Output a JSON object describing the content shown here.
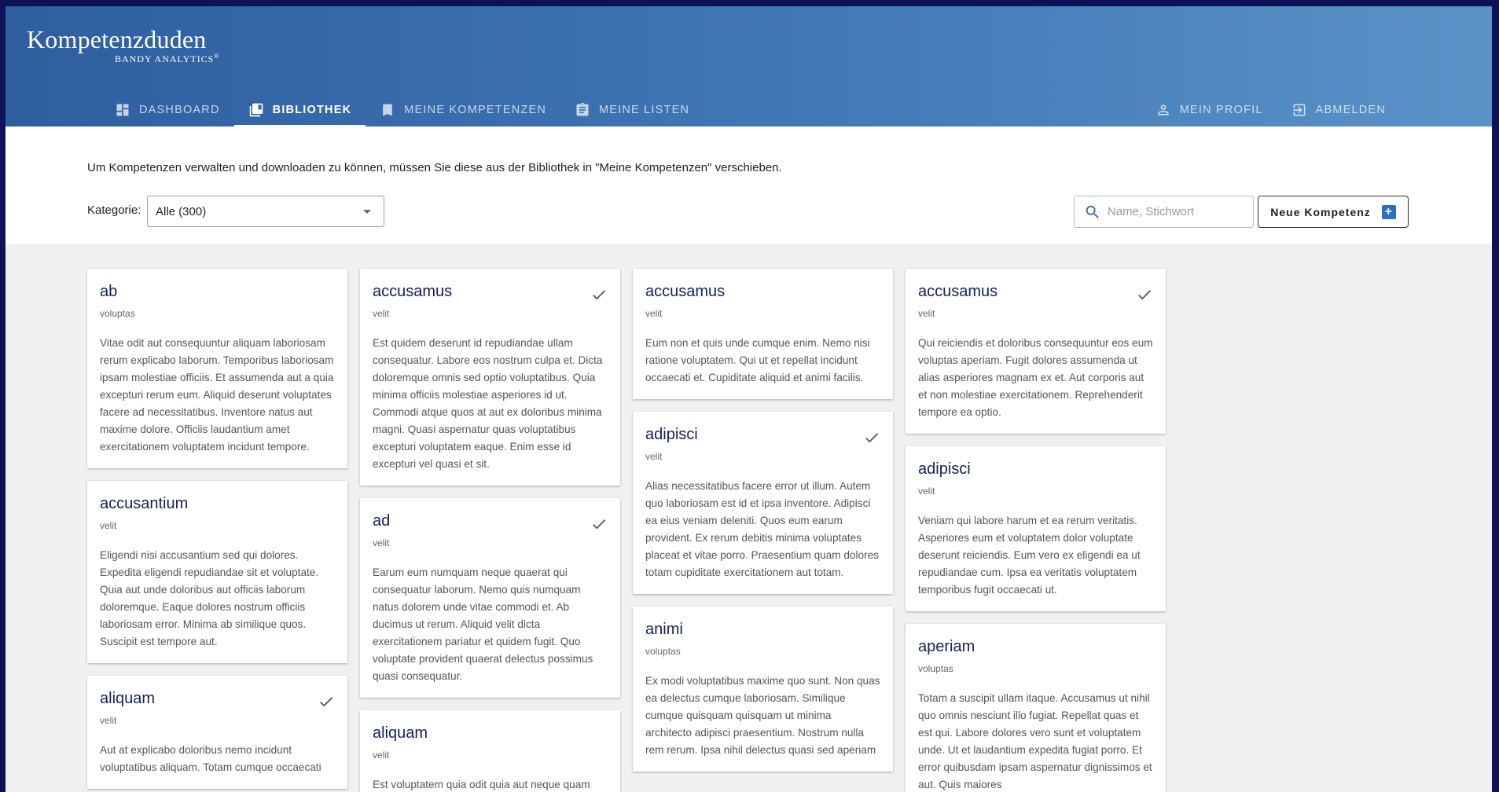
{
  "brand": {
    "title": "Kompetenzduden",
    "subtitle": "BANDY ANALYTICS",
    "reg": "®"
  },
  "nav_left": [
    {
      "label": "DASHBOARD",
      "icon": "dashboard-icon",
      "active": false
    },
    {
      "label": "BIBLIOTHEK",
      "icon": "library-icon",
      "active": true
    },
    {
      "label": "MEINE KOMPETENZEN",
      "icon": "bookmark-icon",
      "active": false
    },
    {
      "label": "MEINE LISTEN",
      "icon": "clipboard-list-icon",
      "active": false
    }
  ],
  "nav_right": [
    {
      "label": "MEIN PROFIL",
      "icon": "person-icon"
    },
    {
      "label": "ABMELDEN",
      "icon": "logout-icon"
    }
  ],
  "toolbar": {
    "info": "Um Kompetenzen verwalten und downloaden zu können, müssen Sie diese aus der Bibliothek in \"Meine Kompetenzen\" verschieben.",
    "category_label": "Kategorie:",
    "category_value": "Alle (300)",
    "search_placeholder": "Name, Stichwort",
    "new_button": "Neue Kompetenz"
  },
  "columns": [
    [
      {
        "title": "ab",
        "category": "voluptas",
        "checked": false,
        "description": "Vitae odit aut consequuntur aliquam laboriosam rerum explicabo laborum. Temporibus laboriosam ipsam molestiae officiis. Et assumenda aut a quia excepturi rerum eum. Aliquid deserunt voluptates facere ad necessitatibus. Inventore natus aut maxime dolore. Officiis laudantium amet exercitationem voluptatem incidunt tempore."
      },
      {
        "title": "accusantium",
        "category": "velit",
        "checked": false,
        "description": "Eligendi nisi accusantium sed qui dolores. Expedita eligendi repudiandae sit et voluptate. Quia aut unde doloribus aut officiis laborum doloremque. Eaque dolores nostrum officiis laboriosam error. Minima ab similique quos. Suscipit est tempore aut."
      },
      {
        "title": "aliquam",
        "category": "velit",
        "checked": true,
        "description": "Aut at explicabo doloribus nemo incidunt voluptatibus aliquam. Totam cumque occaecati"
      }
    ],
    [
      {
        "title": "accusamus",
        "category": "velit",
        "checked": true,
        "description": "Est quidem deserunt id repudiandae ullam consequatur. Labore eos nostrum culpa et. Dicta doloremque omnis sed optio voluptatibus. Quia minima officiis molestiae asperiores id ut. Commodi atque quos at aut ex doloribus minima magni. Quasi aspernatur quas voluptatibus excepturi voluptatem eaque. Enim esse id excepturi vel quasi et sit."
      },
      {
        "title": "ad",
        "category": "velit",
        "checked": true,
        "description": "Earum eum numquam neque quaerat qui consequatur laborum. Nemo quis numquam natus dolorem unde vitae commodi et. Ab ducimus ut rerum. Aliquid velit dicta exercitationem pariatur et quidem fugit. Quo voluptate provident quaerat delectus possimus quasi consequatur."
      },
      {
        "title": "aliquam",
        "category": "velit",
        "checked": false,
        "description": "Est voluptatem quia odit quia aut neque quam"
      }
    ],
    [
      {
        "title": "accusamus",
        "category": "velit",
        "checked": false,
        "description": "Eum non et quis unde cumque enim. Nemo nisi ratione voluptatem. Qui ut et repellat incidunt occaecati et. Cupiditate aliquid et animi facilis."
      },
      {
        "title": "adipisci",
        "category": "velit",
        "checked": true,
        "description": "Alias necessitatibus facere error ut illum. Autem quo laboriosam est id et ipsa inventore. Adipisci ea eius veniam deleniti. Quos eum earum provident. Ex rerum debitis minima voluptates placeat et vitae porro. Praesentium quam dolores totam cupiditate exercitationem aut totam."
      },
      {
        "title": "animi",
        "category": "voluptas",
        "checked": false,
        "description": "Ex modi voluptatibus maxime quo sunt. Non quas ea delectus cumque laboriosam. Similique cumque quisquam quisquam ut minima architecto adipisci praesentium. Nostrum nulla rem rerum. Ipsa nihil delectus quasi sed aperiam"
      }
    ],
    [
      {
        "title": "accusamus",
        "category": "velit",
        "checked": true,
        "description": "Qui reiciendis et doloribus consequuntur eos eum voluptas aperiam. Fugit dolores assumenda ut alias asperiores magnam ex et. Aut corporis aut et non molestiae exercitationem. Reprehenderit tempore ea optio."
      },
      {
        "title": "adipisci",
        "category": "velit",
        "checked": false,
        "description": "Veniam qui labore harum et ea rerum veritatis. Asperiores eum et voluptatem dolor voluptate deserunt reiciendis. Eum vero ex eligendi ea ut repudiandae cum. Ipsa ea veritatis voluptatem temporibus fugit occaecati ut."
      },
      {
        "title": "aperiam",
        "category": "voluptas",
        "checked": false,
        "description": "Totam a suscipit ullam itaque. Accusamus ut nihil quo omnis nesciunt illo fugiat. Repellat quas et est qui. Labore dolores vero sunt et voluptatem unde. Ut et laudantium expedita fugiat porro. Et error quibusdam ipsam aspernatur dignissimos et aut. Quis maiores"
      }
    ]
  ]
}
